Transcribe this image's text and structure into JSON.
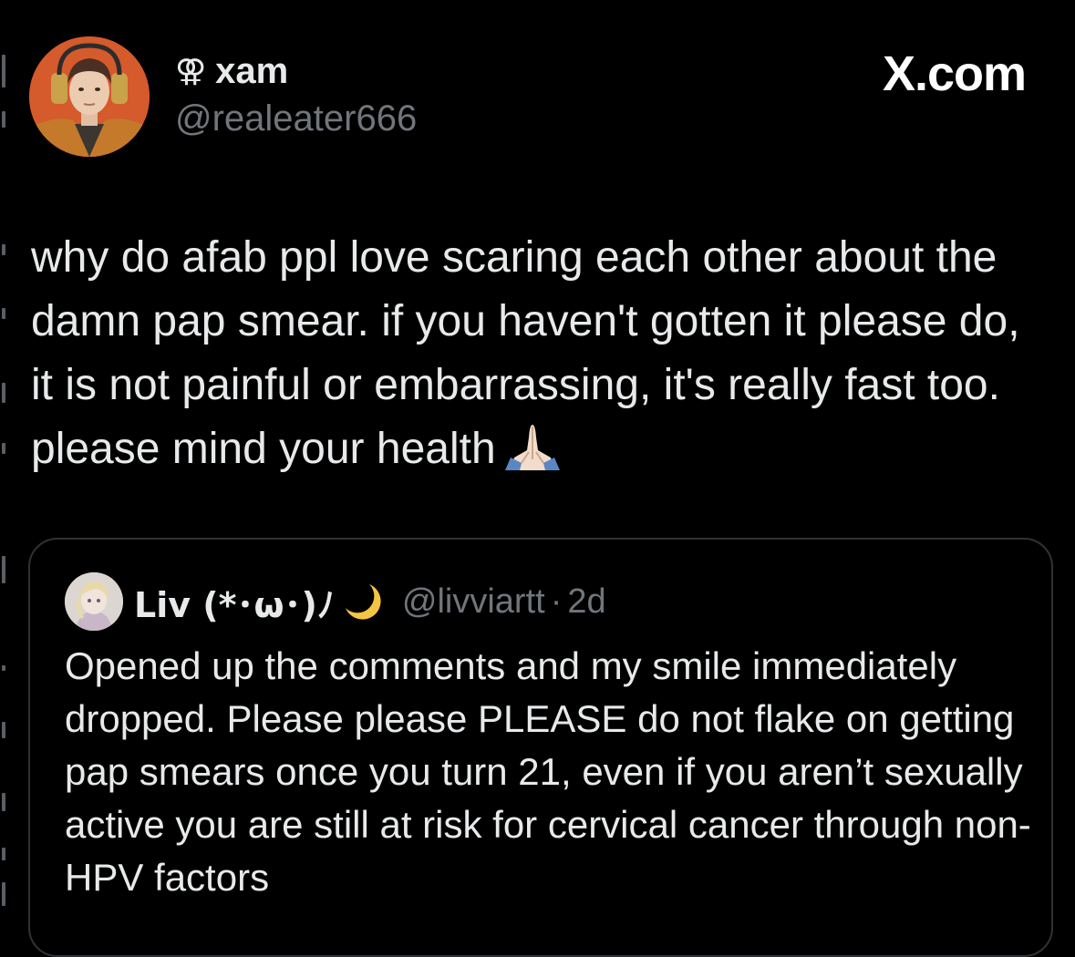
{
  "site": {
    "brand": "X.com"
  },
  "tweet": {
    "author": {
      "name_symbol": "⚢",
      "name": "xam",
      "handle": "@realeater666"
    },
    "text": "why do afab ppl love scaring each other about the damn pap smear. if you haven't gotten it please do, it is not painful or embarrassing, it's really fast too. please mind your health"
  },
  "quoted_tweet": {
    "author": {
      "name": "Liv (*･ω･)ﾉ",
      "handle": "@livviartt",
      "separator": "·",
      "time": "2d"
    },
    "text": "Opened up the comments and my smile immediately dropped. Please please PLEASE do not flake on getting pap smears once you turn 21, even if you aren’t sexually active you are still at risk for cervical cancer through non-HPV factors"
  },
  "icons": {
    "tweet_emoji": "folded-hands-icon",
    "name_emoji": "crescent-moon-icon"
  },
  "colors": {
    "background": "#000000",
    "primary_text": "#e7e9ea",
    "secondary_text": "#71767b",
    "border": "#2f3336",
    "moon": "#f4c542"
  }
}
